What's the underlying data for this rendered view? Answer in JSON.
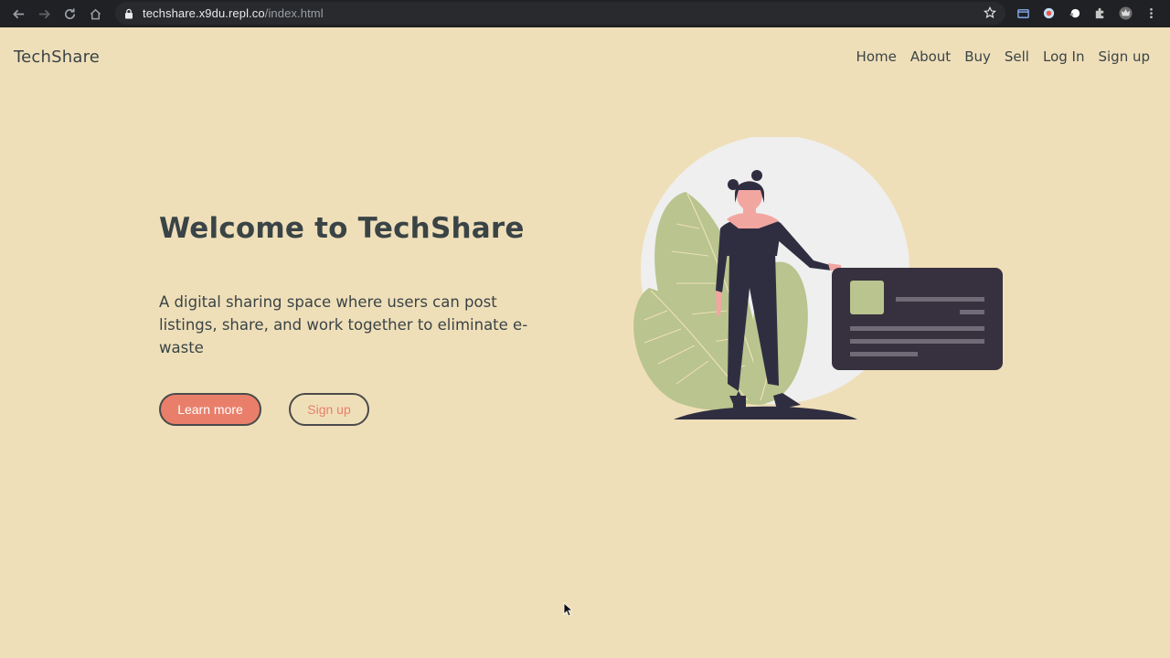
{
  "browser": {
    "url_host": "techshare.x9du.repl.co",
    "url_path": "/index.html",
    "icons": [
      "back-icon",
      "forward-icon",
      "reload-icon",
      "home-icon",
      "lock-icon",
      "star-icon",
      "extension-icon",
      "puzzle-icon",
      "menu-icon"
    ]
  },
  "site": {
    "brand": "TechShare",
    "nav": [
      "Home",
      "About",
      "Buy",
      "Sell",
      "Log In",
      "Sign up"
    ]
  },
  "hero": {
    "title": "Welcome to TechShare",
    "description": "A digital sharing space where users can post listings, share, and work together to eliminate e-waste",
    "primary_button": "Learn more",
    "secondary_button": "Sign up"
  },
  "colors": {
    "background": "#efdfb9",
    "accent": "#e97f6b",
    "text": "#3a4446",
    "card": "#37313f",
    "leaf": "#b9c48e"
  }
}
